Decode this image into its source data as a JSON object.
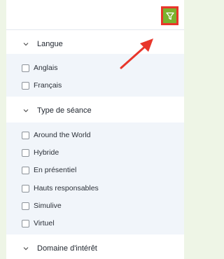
{
  "toolbar": {
    "filter_icon": "filter-icon",
    "accent_color": "#7bb32e",
    "highlight_color": "#e8362b"
  },
  "sections": [
    {
      "title": "Langue",
      "expanded": true,
      "options": [
        "Anglais",
        "Français"
      ]
    },
    {
      "title": "Type de séance",
      "expanded": true,
      "options": [
        "Around the World",
        "Hybride",
        "En présentiel",
        "Hauts responsables",
        "Simulive",
        "Virtuel"
      ]
    },
    {
      "title": "Domaine d'intérêt",
      "expanded": true,
      "options": []
    }
  ]
}
